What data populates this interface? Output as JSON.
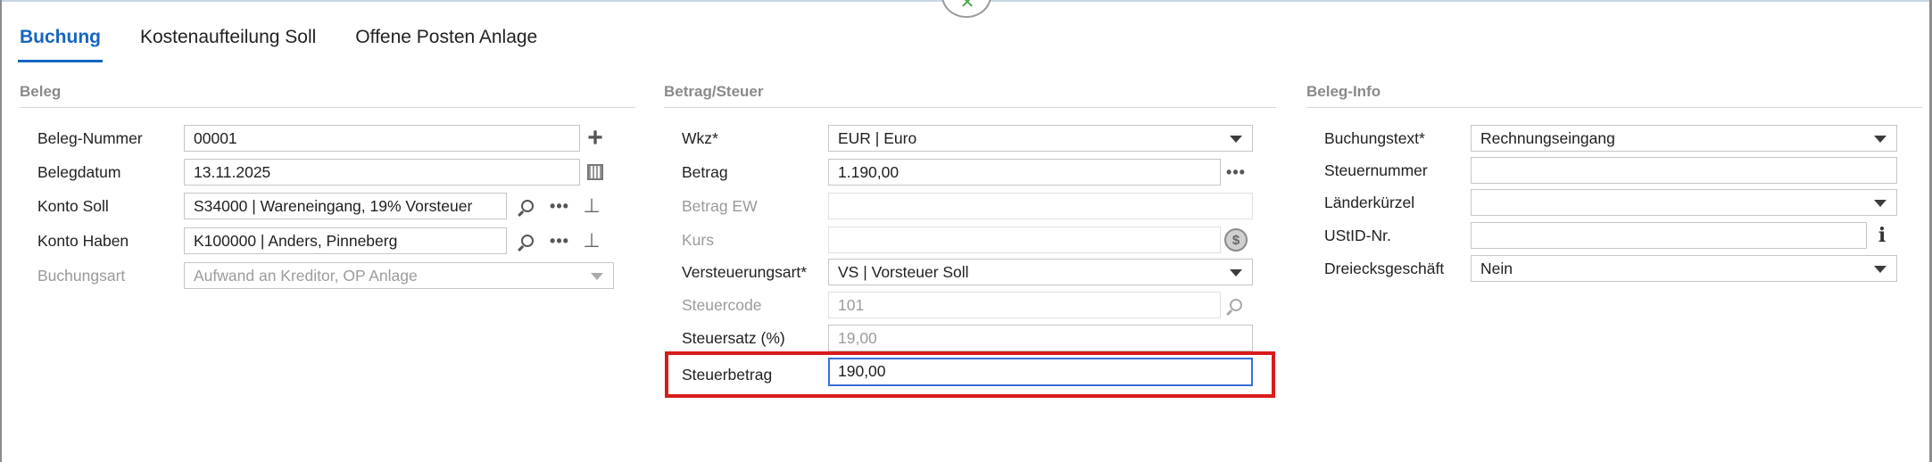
{
  "tabs": [
    {
      "label": "Buchung",
      "active": true
    },
    {
      "label": "Kostenaufteilung Soll",
      "active": false
    },
    {
      "label": "Offene Posten Anlage",
      "active": false
    }
  ],
  "beleg": {
    "title": "Beleg",
    "beleg_nummer": {
      "label": "Beleg-Nummer",
      "value": "00001"
    },
    "belegdatum": {
      "label": "Belegdatum",
      "value": "13.11.2025"
    },
    "konto_soll": {
      "label": "Konto Soll",
      "value": "S34000  |  Wareneingang, 19% Vorsteuer"
    },
    "konto_haben": {
      "label": "Konto Haben",
      "value": "K100000  |  Anders, Pinneberg"
    },
    "buchungsart": {
      "label": "Buchungsart",
      "value": "Aufwand an Kreditor, OP Anlage"
    }
  },
  "betrag_steuer": {
    "title": "Betrag/Steuer",
    "wkz": {
      "label": "Wkz*",
      "value": "EUR  |  Euro"
    },
    "betrag": {
      "label": "Betrag",
      "value": "1.190,00"
    },
    "betrag_ew": {
      "label": "Betrag EW",
      "value": ""
    },
    "kurs": {
      "label": "Kurs",
      "value": ""
    },
    "versteuerungsart": {
      "label": "Versteuerungsart*",
      "value": "VS  |  Vorsteuer Soll"
    },
    "steuercode": {
      "label": "Steuercode",
      "value": "101"
    },
    "steuersatz": {
      "label": "Steuersatz (%)",
      "value": "19,00"
    },
    "steuerbetrag": {
      "label": "Steuerbetrag",
      "value": "190,00"
    }
  },
  "beleg_info": {
    "title": "Beleg-Info",
    "buchungstext": {
      "label": "Buchungstext*",
      "value": "Rechnungseingang"
    },
    "steuernummer": {
      "label": "Steuernummer",
      "value": ""
    },
    "laenderkuerzel": {
      "label": "Länderkürzel",
      "value": ""
    },
    "ustid": {
      "label": "UStID-Nr.",
      "value": ""
    },
    "dreiecksgeschaeft": {
      "label": "Dreiecksgeschäft",
      "value": "Nein"
    }
  },
  "icons": {
    "add": "plus-icon",
    "calendar": "calendar-icon",
    "search": "search-icon",
    "more": "more-icon",
    "pin": "pin-icon",
    "dropdown": "chevron-down-icon",
    "currency": "currency-convert-icon",
    "info": "info-icon",
    "close": "close-icon"
  },
  "colors": {
    "accent": "#1565c0",
    "highlight": "#d81b1b",
    "focus": "#3a6fd8"
  }
}
